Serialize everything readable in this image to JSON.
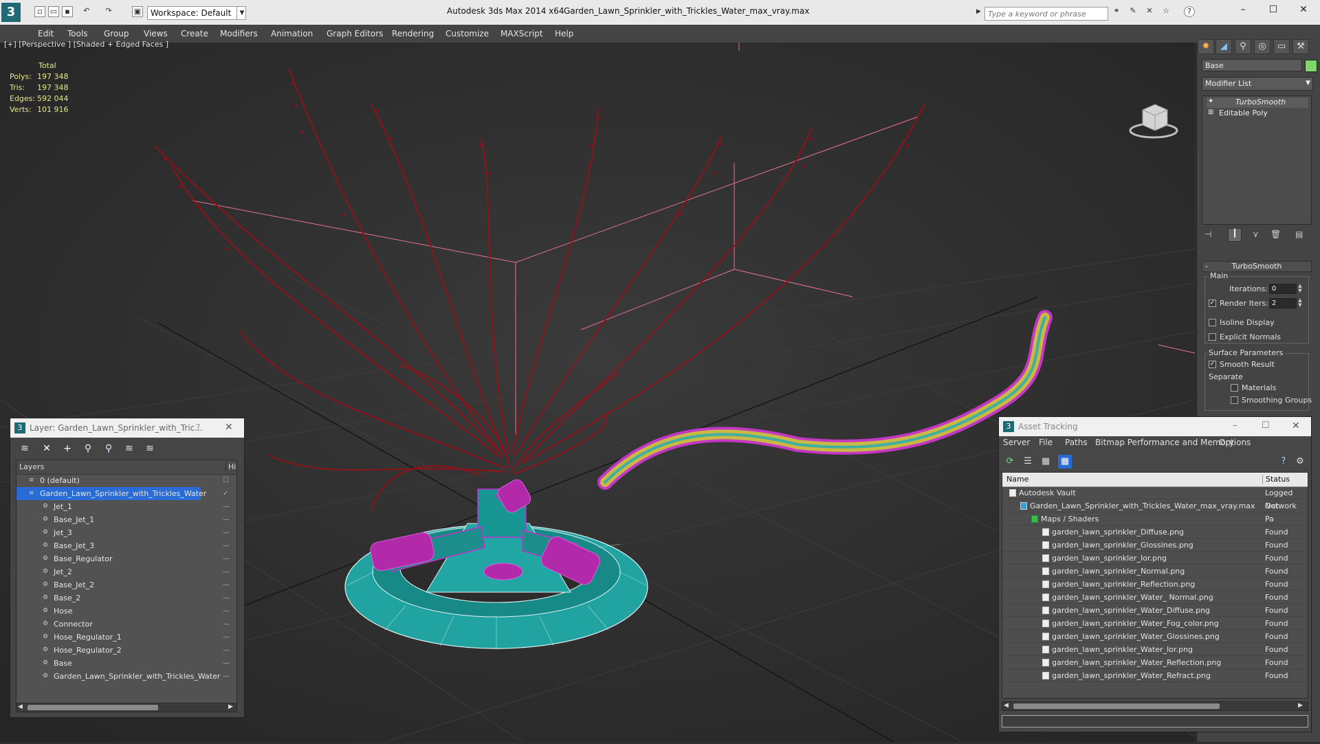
{
  "titlebar": {
    "app": "Autodesk 3ds Max  2014 x64",
    "file": "Garden_Lawn_Sprinkler_with_Trickles_Water_max_vray.max",
    "workspace": "Workspace: Default",
    "search_placeholder": "Type a keyword or phrase"
  },
  "menu": [
    "Edit",
    "Tools",
    "Group",
    "Views",
    "Create",
    "Modifiers",
    "Animation",
    "Graph Editors",
    "Rendering",
    "Customize",
    "MAXScript",
    "Help"
  ],
  "viewport": {
    "label": "[+] [Perspective ] [Shaded + Edged Faces ]",
    "stats": {
      "header": "Total",
      "rows": [
        {
          "label": "Polys:",
          "value": "197 348"
        },
        {
          "label": "Tris:",
          "value": "197 348"
        },
        {
          "label": "Edges:",
          "value": "592 044"
        },
        {
          "label": "Verts:",
          "value": "101 916"
        }
      ]
    }
  },
  "command_panel": {
    "object_name": "Base",
    "modifier_list": "Modifier List",
    "stack": [
      "TurboSmooth",
      "Editable Poly"
    ],
    "rollout_title": "TurboSmooth",
    "main_group": "Main",
    "iterations_label": "Iterations:",
    "iterations_value": "0",
    "render_iters_label": "Render Iters:",
    "render_iters_value": "2",
    "isoline_label": "Isoline Display",
    "explicit_label": "Explicit Normals",
    "surface_group": "Surface Parameters",
    "smooth_result_label": "Smooth Result",
    "separate_label": "Separate",
    "materials_label": "Materials",
    "smoothing_groups_label": "Smoothing Groups"
  },
  "layer_dialog": {
    "title": "Layer: Garden_Lawn_Sprinkler_with_Tric...",
    "help": "?",
    "col_layers": "Layers",
    "col_hide": "Hid",
    "rows": [
      {
        "name": "0 (default)",
        "level": 0
      },
      {
        "name": "Garden_Lawn_Sprinkler_with_Trickles_Water",
        "level": 0,
        "selected": true
      },
      {
        "name": "Jet_1",
        "level": 1
      },
      {
        "name": "Base_Jet_1",
        "level": 1
      },
      {
        "name": "Jet_3",
        "level": 1
      },
      {
        "name": "Base_Jet_3",
        "level": 1
      },
      {
        "name": "Base_Regulator",
        "level": 1
      },
      {
        "name": "Jet_2",
        "level": 1
      },
      {
        "name": "Base_Jet_2",
        "level": 1
      },
      {
        "name": "Base_2",
        "level": 1
      },
      {
        "name": "Hose",
        "level": 1
      },
      {
        "name": "Connector",
        "level": 1
      },
      {
        "name": "Hose_Regulator_1",
        "level": 1
      },
      {
        "name": "Hose_Regulator_2",
        "level": 1
      },
      {
        "name": "Base",
        "level": 1
      },
      {
        "name": "Garden_Lawn_Sprinkler_with_Trickles_Water",
        "level": 1
      }
    ]
  },
  "asset_dialog": {
    "title": "Asset Tracking",
    "menus": [
      "Server",
      "File",
      "Paths",
      "Bitmap Performance and Memory",
      "Options"
    ],
    "col_name": "Name",
    "col_status": "Status",
    "rows": [
      {
        "name": "Autodesk Vault",
        "status": "Logged Out",
        "level": 0
      },
      {
        "name": "Garden_Lawn_Sprinkler_with_Trickles_Water_max_vray.max",
        "status": "Network Pa",
        "level": 1
      },
      {
        "name": "Maps / Shaders",
        "status": "",
        "level": 2
      },
      {
        "name": "garden_lawn_sprinkler_Diffuse.png",
        "status": "Found",
        "level": 3
      },
      {
        "name": "garden_lawn_sprinkler_Glossines.png",
        "status": "Found",
        "level": 3
      },
      {
        "name": "garden_lawn_sprinkler_Ior.png",
        "status": "Found",
        "level": 3
      },
      {
        "name": "garden_lawn_sprinkler_Normal.png",
        "status": "Found",
        "level": 3
      },
      {
        "name": "garden_lawn_sprinkler_Reflection.png",
        "status": "Found",
        "level": 3
      },
      {
        "name": "garden_lawn_sprinkler_Water_ Normal.png",
        "status": "Found",
        "level": 3
      },
      {
        "name": "garden_lawn_sprinkler_Water_Diffuse.png",
        "status": "Found",
        "level": 3
      },
      {
        "name": "garden_lawn_sprinkler_Water_Fog_color.png",
        "status": "Found",
        "level": 3
      },
      {
        "name": "garden_lawn_sprinkler_Water_Glossines.png",
        "status": "Found",
        "level": 3
      },
      {
        "name": "garden_lawn_sprinkler_Water_Ior.png",
        "status": "Found",
        "level": 3
      },
      {
        "name": "garden_lawn_sprinkler_Water_Reflection.png",
        "status": "Found",
        "level": 3
      },
      {
        "name": "garden_lawn_sprinkler_Water_Refract.png",
        "status": "Found",
        "level": 3
      }
    ]
  },
  "colors": {
    "teal_mesh": "#1fa7a4",
    "magenta_wire": "#d02ad0",
    "water": "#a0101a",
    "selection": "#2a6cd6",
    "stats": "#e6e68a"
  }
}
